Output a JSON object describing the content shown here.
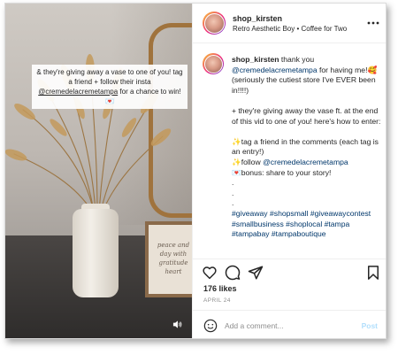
{
  "post": {
    "overlay_pre": "& they're giving away a vase to one of you! tag a friend + follow their insta",
    "overlay_handle": "@cremedelacremetampa",
    "overlay_post": " for a chance to win!",
    "sign_text": "peace and day with gratitude heart"
  },
  "header": {
    "username": "shop_kirsten",
    "subtitle": "Retro Aesthetic Boy • Coffee for Two"
  },
  "caption": {
    "username": "shop_kirsten",
    "l1a": " thank you ",
    "l1_handle": "@cremedelacremetampa",
    "l1b": " for having me!🥰(seriously the cutiest store I've EVER been in!!!!)",
    "l2": "+ they're giving away the vase ft. at the end of this vid to one of you! here's how to enter:",
    "l3": "✨tag a friend in the comments (each tag is an entry!)",
    "l4a": "✨follow ",
    "l4_handle": "@cremedelacremetampa",
    "l5": "💌bonus: share to your story!",
    "dot1": ".",
    "dot2": ".",
    "dot3": ".",
    "tags1": "#giveaway #shopsmall #giveawaycontest #smallbusiness #shoplocal #tampa #tampabay #tampaboutique"
  },
  "stats": {
    "likes": "176 likes",
    "date": "APRIL 24"
  },
  "comment": {
    "placeholder": "Add a comment...",
    "post_label": "Post"
  },
  "colors": {
    "link": "#00376b",
    "post_disabled": "#b2dffc",
    "muted": "#8e8e8e"
  },
  "icons": [
    "volume-icon",
    "more-icon",
    "heart-icon",
    "comment-icon",
    "share-icon",
    "bookmark-icon",
    "emoji-icon"
  ]
}
